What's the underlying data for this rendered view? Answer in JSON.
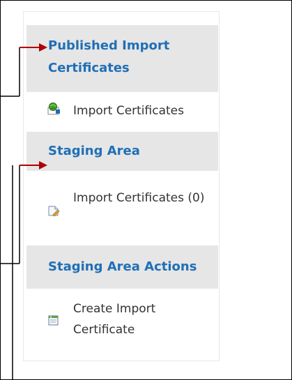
{
  "sidebar": {
    "sections": [
      {
        "header": "Published Import Certificates",
        "item_label": "Import Certificates",
        "icon": "globe-document-icon"
      },
      {
        "header": "Staging Area",
        "item_label": "Import Certificates (0)",
        "icon": "document-icon"
      },
      {
        "header": "Staging Area Actions",
        "item_label": "Create Import Certificate",
        "icon": "new-document-icon"
      }
    ]
  },
  "colors": {
    "header_text": "#1f6fb7",
    "header_bg": "#e6e6e6",
    "item_text": "#333333",
    "arrow": "#b00000"
  }
}
